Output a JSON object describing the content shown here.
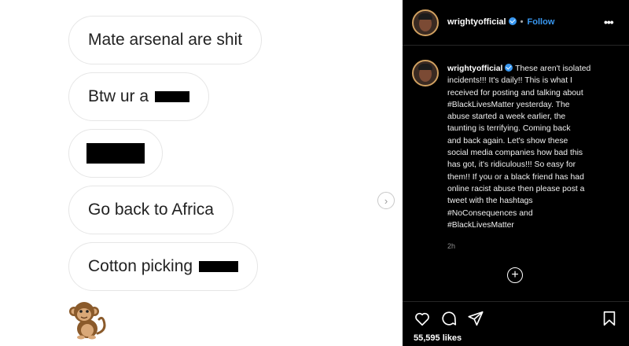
{
  "image": {
    "messages": [
      {
        "text": "Mate arsenal are shit",
        "redacted": false
      },
      {
        "text": "Btw ur a",
        "redacted": true
      },
      {
        "text": "",
        "redacted": true
      },
      {
        "text": "Go back to Africa",
        "redacted": false
      },
      {
        "text": "Cotton picking",
        "redacted": true
      }
    ],
    "emoji_icon": "monkey-emoji",
    "next_icon": "chevron-right-icon",
    "next_glyph": "›"
  },
  "header": {
    "username": "wrightyofficial",
    "separator": "•",
    "follow_label": "Follow",
    "more_glyph": "•••"
  },
  "caption": {
    "username": "wrightyofficial",
    "lines": [
      "These aren't isolated",
      "incidents!!! It's daily!! This is what I",
      "received for posting and talking about",
      "#BlackLivesMatter yesterday. The",
      "abuse started a week earlier, the",
      "taunting is terrifying. Coming back",
      "and back again. Let's show these",
      "social media companies how bad this",
      "has got, it's ridiculous!!! So easy for",
      "them!! If you or a black friend has had",
      "online racist abuse then please post a",
      "tweet with the hashtags",
      "#NoConsequences and",
      "#BlackLivesMatter"
    ],
    "timestamp": "2h",
    "add_glyph": "+"
  },
  "actions": {
    "likes_label": "55,595 likes"
  },
  "colors": {
    "accent": "#3897f0",
    "panel_bg": "#000000",
    "bubble_border": "#e6e6e6"
  }
}
